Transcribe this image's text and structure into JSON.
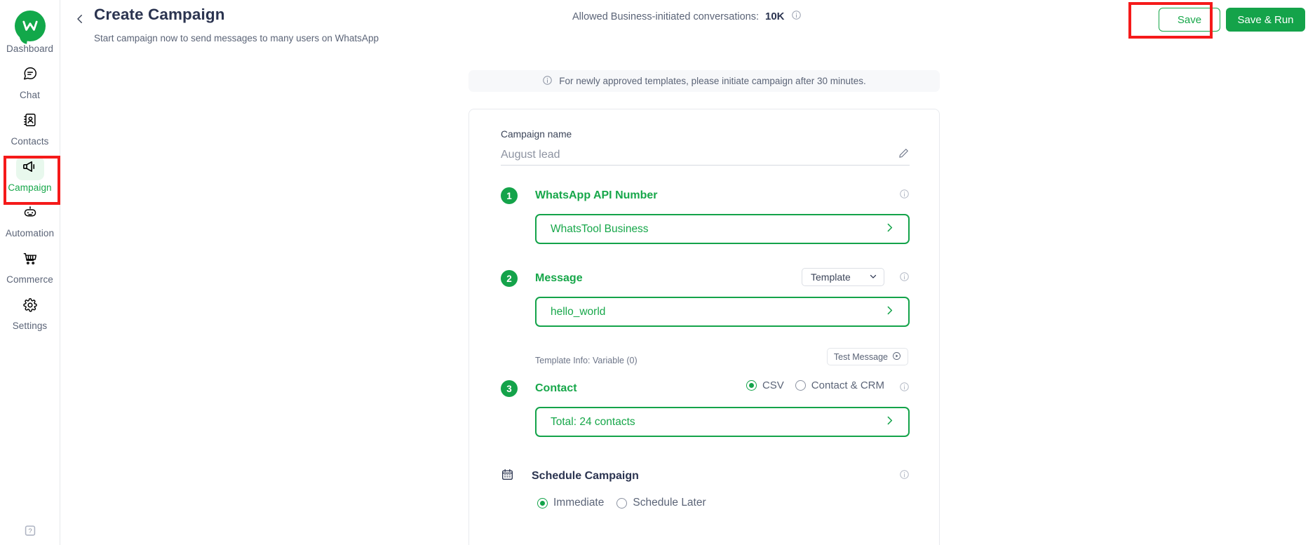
{
  "sidebar": {
    "logo_icon": "whatstool-logo-icon",
    "items": [
      {
        "label": "Dashboard",
        "icon": "whatstool-logo-icon",
        "active": false
      },
      {
        "label": "Chat",
        "icon": "chat-bubble-icon",
        "active": false
      },
      {
        "label": "Contacts",
        "icon": "contacts-book-icon",
        "active": false
      },
      {
        "label": "Campaign",
        "icon": "megaphone-icon",
        "active": true
      },
      {
        "label": "Automation",
        "icon": "robot-icon",
        "active": false
      },
      {
        "label": "Commerce",
        "icon": "shopping-cart-icon",
        "active": false
      },
      {
        "label": "Settings",
        "icon": "gear-icon",
        "active": false
      }
    ],
    "help_icon": "help-question-icon"
  },
  "header": {
    "back_icon": "chevron-left-icon",
    "title": "Create Campaign",
    "subtitle": "Start campaign now to send messages to many users on WhatsApp",
    "allowed_label": "Allowed Business-initiated conversations:",
    "allowed_value": "10K",
    "allowed_info_icon": "info-circle-icon",
    "save_label": "Save",
    "save_run_label": "Save & Run"
  },
  "notice": {
    "icon": "info-circle-icon",
    "text": "For newly approved templates, please initiate campaign after 30 minutes."
  },
  "form": {
    "campaign_name_label": "Campaign name",
    "campaign_name_value": "August lead",
    "edit_icon": "pencil-icon",
    "steps": [
      {
        "number": "1",
        "title": "WhatsApp API Number",
        "info_icon": "info-circle-icon",
        "selector_value": "WhatsTool Business",
        "selector_chevron": "chevron-right-icon"
      },
      {
        "number": "2",
        "title": "Message",
        "info_icon": "info-circle-icon",
        "dropdown_value": "Template",
        "dropdown_chevron": "chevron-down-icon",
        "selector_value": "hello_world",
        "selector_chevron": "chevron-right-icon",
        "template_info": "Template Info: Variable (0)",
        "test_message_label": "Test Message",
        "test_message_icon": "play-circle-icon"
      },
      {
        "number": "3",
        "title": "Contact",
        "info_icon": "info-circle-icon",
        "radios": [
          {
            "label": "CSV",
            "selected": true
          },
          {
            "label": "Contact & CRM",
            "selected": false
          }
        ],
        "selector_value": "Total: 24 contacts",
        "selector_chevron": "chevron-right-icon"
      }
    ],
    "schedule": {
      "icon": "calendar-icon",
      "title": "Schedule Campaign",
      "info_icon": "info-circle-icon",
      "radios": [
        {
          "label": "Immediate",
          "selected": true
        },
        {
          "label": "Schedule Later",
          "selected": false
        }
      ]
    }
  },
  "highlights": {
    "color": "#f51a1a",
    "targets": [
      "sidebar-item-campaign",
      "save-button"
    ]
  }
}
